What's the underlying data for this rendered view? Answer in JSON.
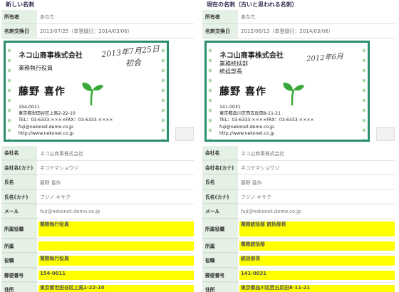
{
  "left": {
    "title": "新しい名刺",
    "owner_label": "所有者",
    "owner_value": "あなた",
    "exchanged_label": "名刺交換日",
    "exchanged_value": "2013/07/25（本登録日：2014/03/06）",
    "card": {
      "company": "ネコ山商事株式会社",
      "handwritten_date": "2013年7月25日",
      "handwritten_note": "初会",
      "role_lines": [
        "業務執行役員"
      ],
      "name": "藤野 喜作",
      "postal": "154-0011",
      "address": "東京都世田谷区上馬2-22-10",
      "tel_fax": "TEL：03-6333-××××FAX：03-6333-××××",
      "email": "fuji@nekonet.demo.co.jp",
      "url": "http://www.nekonet.co.jp"
    },
    "rows": [
      {
        "label": "会社名",
        "value": "ネコ山商事株式会社",
        "hl": false
      },
      {
        "label": "会社名(カナ)",
        "value": "ネコヤマショウジ",
        "hl": false
      },
      {
        "label": "氏名",
        "value": "藤野 喜作",
        "hl": false
      },
      {
        "label": "氏名(カナ)",
        "value": "フジノ キサク",
        "hl": false
      },
      {
        "label": "メール",
        "value": "fuji@nekonet.demo.co.jp",
        "hl": false
      },
      {
        "label": "所属役職",
        "value": "業務執行役員",
        "hl": true
      },
      {
        "label": "所属",
        "value": "",
        "hl": true
      },
      {
        "label": "役職",
        "value": "業務執行役員",
        "hl": true
      },
      {
        "label": "郵便番号",
        "value": "154-0011",
        "hl": true
      },
      {
        "label": "住所",
        "value": "東京都世田谷区上馬2-22-10",
        "hl": true
      }
    ]
  },
  "right": {
    "title": "現在の名刺（古いと思われる名刺）",
    "owner_label": "所有者",
    "owner_value": "あなた",
    "exchanged_label": "名刺交換日",
    "exchanged_value": "2012/06/13（本登録日：2014/03/06）",
    "card": {
      "company": "ネコ山商事株式会社",
      "handwritten_date": "2012年6月",
      "role_lines": [
        "業務統括部",
        "統括部長"
      ],
      "name": "藤野 喜作",
      "postal": "141-0031",
      "address": "東京都品川区西五反田8-11-21",
      "tel_fax": "TEL：03-6333-××××FAX：03-6333-××××",
      "email": "fuji@nekonet.demo.co.jp",
      "url": "http://www.nekonet.co.jp"
    },
    "rows": [
      {
        "label": "会社名",
        "value": "ネコ山商事株式会社",
        "hl": false
      },
      {
        "label": "会社名(カナ)",
        "value": "ネコヤマショウジ",
        "hl": false
      },
      {
        "label": "氏名",
        "value": "藤野 喜作",
        "hl": false
      },
      {
        "label": "氏名(カナ)",
        "value": "フジノ キサク",
        "hl": false
      },
      {
        "label": "メール",
        "value": "fuji@nekonet.demo.co.jp",
        "hl": false
      },
      {
        "label": "所属役職",
        "value": "業務統括部 統括部長",
        "hl": true
      },
      {
        "label": "所属",
        "value": "業務統括部",
        "hl": true
      },
      {
        "label": "役職",
        "value": "統括部長",
        "hl": true
      },
      {
        "label": "郵便番号",
        "value": "141-0031",
        "hl": true
      },
      {
        "label": "住所",
        "value": "東京都品川区西五反田8-11-21",
        "hl": true
      }
    ]
  },
  "colors": {
    "accent": "#2a8f6a",
    "label_bg": "#e6f1e6",
    "highlight": "#ffff00"
  }
}
